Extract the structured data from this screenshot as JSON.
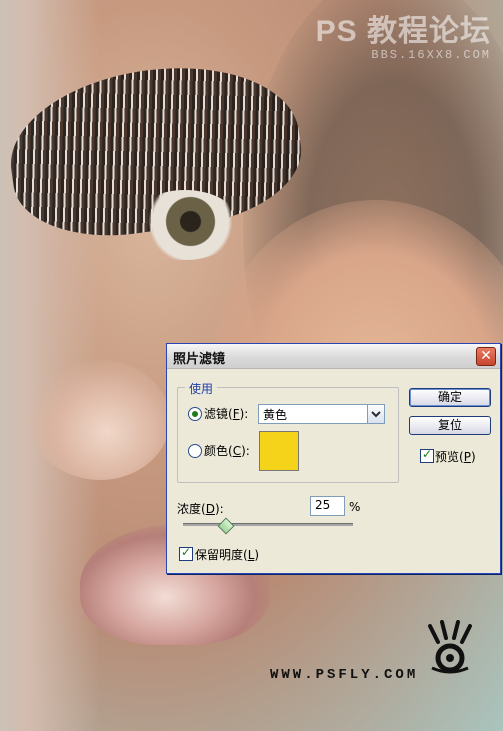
{
  "watermarks": {
    "top_title": "PS 教程论坛",
    "top_url": "BBS.16XX8.COM",
    "bottom_site": "WWW.PSFLY.COM"
  },
  "dialog": {
    "title": "照片滤镜",
    "close_glyph": "✕",
    "group_label": "使用",
    "filter_option": {
      "label_prefix": "滤镜(",
      "mnemonic": "F",
      "label_suffix": "):",
      "selected": true
    },
    "filter_select": {
      "value": "黄色"
    },
    "color_option": {
      "label_prefix": "颜色(",
      "mnemonic": "C",
      "label_suffix": "):",
      "selected": false
    },
    "color_swatch": "#F6D31B",
    "buttons": {
      "ok": "确定",
      "reset": "复位"
    },
    "preview": {
      "label_prefix": "预览(",
      "mnemonic": "P",
      "label_suffix": ")",
      "checked": true
    },
    "density": {
      "label_prefix": "浓度(",
      "mnemonic": "D",
      "label_suffix": "):",
      "value": "25",
      "unit": "%",
      "slider_value_percent": 25
    },
    "preserve_luminosity": {
      "label_prefix": "保留明度(",
      "mnemonic": "L",
      "label_suffix": ")",
      "checked": true
    }
  }
}
